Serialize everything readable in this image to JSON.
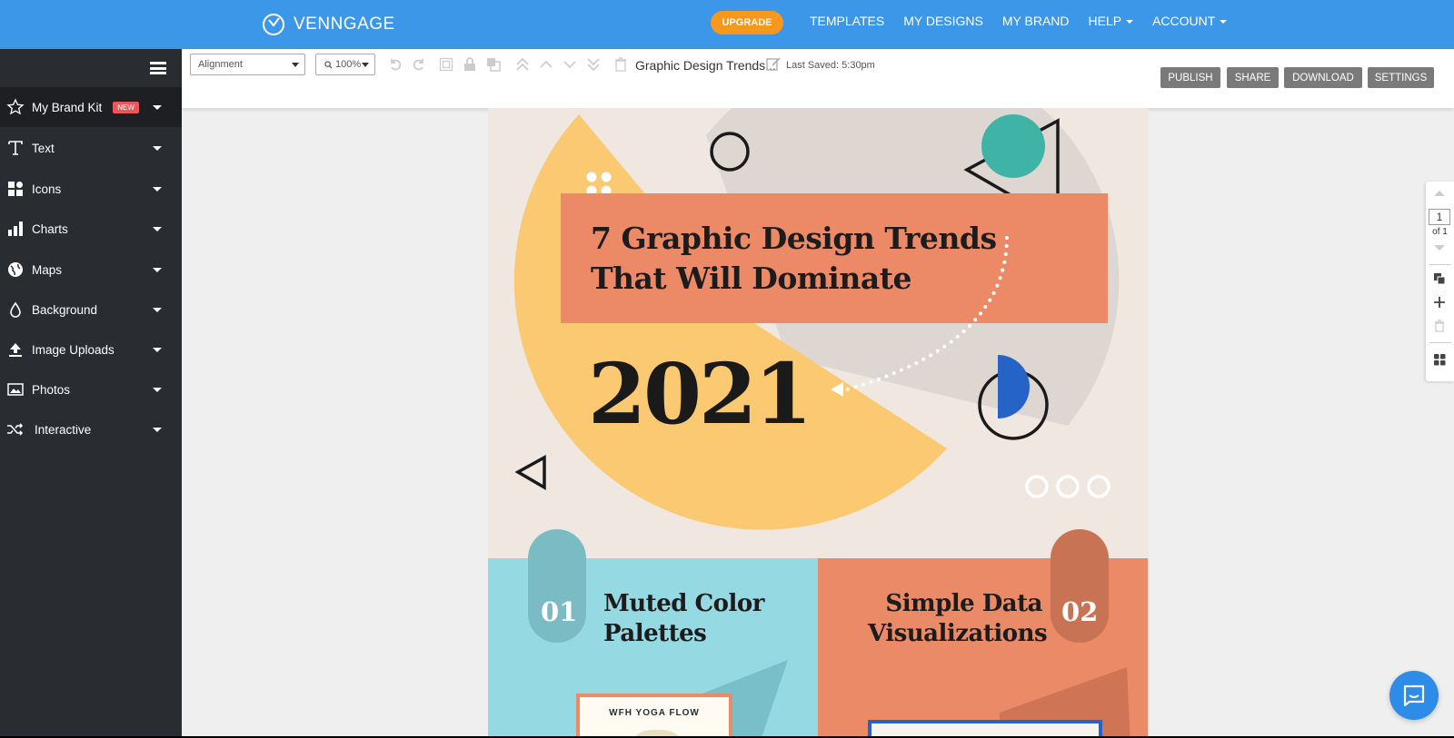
{
  "header": {
    "logo_text": "VENNGAGE",
    "upgrade_label": "UPGRADE",
    "nav": [
      {
        "label": "TEMPLATES"
      },
      {
        "label": "MY DESIGNS"
      },
      {
        "label": "MY BRAND"
      },
      {
        "label": "HELP"
      },
      {
        "label": "ACCOUNT"
      }
    ]
  },
  "sidebar": {
    "items": [
      {
        "label": "My Brand Kit",
        "badge": "NEW",
        "icon": "star-icon"
      },
      {
        "label": "Text",
        "icon": "text-icon"
      },
      {
        "label": "Icons",
        "icon": "icons-grid-icon"
      },
      {
        "label": "Charts",
        "icon": "bar-chart-icon"
      },
      {
        "label": "Maps",
        "icon": "globe-icon"
      },
      {
        "label": "Background",
        "icon": "paint-drop-icon"
      },
      {
        "label": "Image Uploads",
        "icon": "upload-icon"
      },
      {
        "label": "Photos",
        "icon": "photo-icon"
      },
      {
        "label": "Interactive",
        "icon": "shuffle-icon"
      }
    ]
  },
  "toolbar": {
    "alignment_value": "Alignment",
    "zoom_value": "100%",
    "doc_title": "Graphic Design Trends...",
    "last_saved": "Last Saved: 5:30pm",
    "publish_label": "PUBLISH",
    "share_label": "SHARE",
    "download_label": "DOWNLOAD",
    "settings_label": "SETTINGS"
  },
  "canvas": {
    "headline_line1": "7 Graphic Design Trends",
    "headline_line2": "That Will Dominate",
    "year": "2021",
    "item1_num": "01",
    "item1_line1": "Muted Color",
    "item1_line2": "Palettes",
    "item2_num": "02",
    "item2_line1": "Simple Data",
    "item2_line2": "Visualizations",
    "card_text": "WFH YOGA FLOW"
  },
  "pager": {
    "page": "1",
    "of": "of 1"
  },
  "colors": {
    "topbar": "#3d97e9",
    "sidebar": "#292c30",
    "upgrade": "#f6981e",
    "coral": "#ec8a67",
    "yellow": "#fac972",
    "teal": "#3fb4a6",
    "light_blue": "#95d9e2"
  }
}
